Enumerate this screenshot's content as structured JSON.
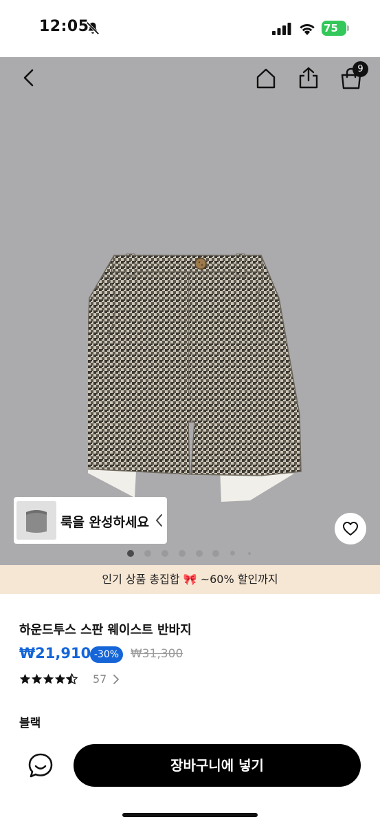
{
  "status_bar": {
    "time": "12:05",
    "battery": "75",
    "icons": [
      "bell-slash-icon",
      "cellular-signal-icon",
      "wifi-icon",
      "battery-icon"
    ]
  },
  "nav": {
    "icons": [
      "back-chevron-icon",
      "home-icon",
      "share-icon",
      "shopping-bag-icon"
    ],
    "cart_count": "9"
  },
  "gallery": {
    "look_banner": "룩을 완성하세요",
    "image_count": 8,
    "current_image": 1
  },
  "promo": {
    "text": "인기 상품 총집합 🎀 ~60% 할인까지"
  },
  "product": {
    "title": "하운드투스 스판 웨이스트 반바지",
    "price": "₩21,910",
    "discount": "-30%",
    "original_price": "₩31,300",
    "rating": 4.5,
    "review_count": "57",
    "color": "블랙"
  },
  "actions": {
    "add_to_cart": "장바구니에 넣기"
  },
  "colors": {
    "accent": "#1565d8",
    "hero_background": "#ababad",
    "promo_background": "#f6e7d4",
    "battery": "#34c759"
  }
}
